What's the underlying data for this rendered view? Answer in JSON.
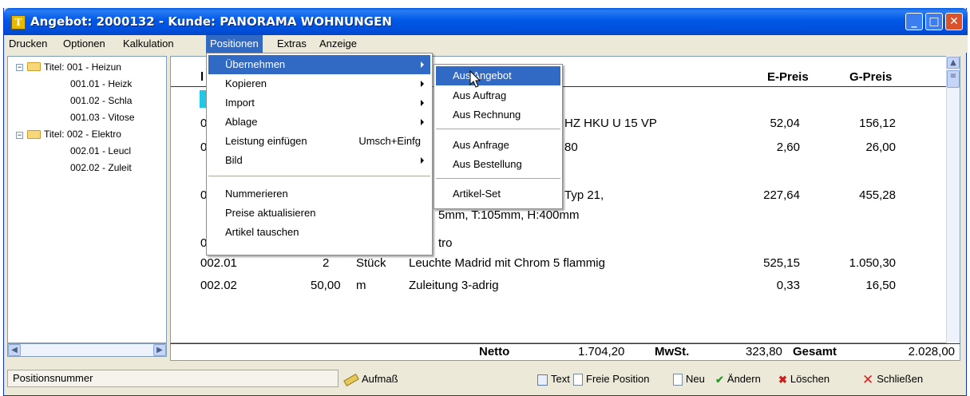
{
  "window": {
    "title": "Angebot: 2000132 - Kunde: PANORAMA WOHNUNGEN",
    "app_icon": "app-logo-icon"
  },
  "menubar": [
    "Drucken",
    "Optionen",
    "Kalkulation",
    "Positionen",
    "Extras",
    "Anzeige"
  ],
  "active_menu": "Positionen",
  "tree": [
    {
      "label": "Titel: 001 - Heizun",
      "level": 0,
      "expanded": true
    },
    {
      "label": "001.01 - Heizk",
      "level": 1
    },
    {
      "label": "001.02 - Schla",
      "level": 1
    },
    {
      "label": "001.03 - Vitose",
      "level": 1
    },
    {
      "label": "Titel: 002 - Elektro",
      "level": 0,
      "expanded": true
    },
    {
      "label": "002.01 - Leucl",
      "level": 1
    },
    {
      "label": "002.02 - Zuleit",
      "level": 1
    }
  ],
  "grid": {
    "headers": {
      "e_preis": "E-Preis",
      "g_preis": "G-Preis"
    },
    "rows": [
      {
        "pos": "0",
        "qty": "",
        "unit": "",
        "text": "HZ HKU U 15 VP",
        "e": "52,04",
        "g": "156,12"
      },
      {
        "pos": "0",
        "qty": "",
        "unit": "",
        "text": "80",
        "e": "2,60",
        "g": "26,00"
      },
      {
        "pos": "0",
        "qty": "",
        "unit": "",
        "text": "Typ 21,",
        "e": "227,64",
        "g": "455,28"
      },
      {
        "pos": "",
        "qty": "",
        "unit": "",
        "text": "5mm, T:105mm, H:400mm",
        "e": "",
        "g": ""
      },
      {
        "pos": "0",
        "qty": "",
        "unit": "",
        "text": "tro",
        "e": "",
        "g": ""
      },
      {
        "pos": "002.01",
        "qty": "2",
        "unit": "Stück",
        "text": "Leuchte Madrid mit Chrom 5 flammig",
        "e": "525,15",
        "g": "1.050,30"
      },
      {
        "pos": "002.02",
        "qty": "50,00",
        "unit": "m",
        "text": "Zuleitung 3-adrig",
        "e": "0,33",
        "g": "16,50"
      }
    ]
  },
  "totals": {
    "netto_label": "Netto",
    "netto": "1.704,20",
    "mwst_label": "MwSt.",
    "mwst": "323,80",
    "gesamt_label": "Gesamt",
    "gesamt": "2.028,00"
  },
  "status": {
    "field": "Positionsnummer",
    "aufmass": "Aufmaß",
    "text": "Text",
    "freie_position": "Freie Position",
    "neu": "Neu",
    "aendern": "Ändern",
    "loeschen": "Löschen",
    "schliessen": "Schließen"
  },
  "positionen_menu": {
    "items": [
      "Übernehmen",
      "Kopieren",
      "Import",
      "Ablage",
      "Leistung einfügen",
      "Bild",
      "Nummerieren",
      "Preise aktualisieren",
      "Artikel tauschen"
    ],
    "shortcut_leistung": "Umsch+Einfg"
  },
  "uebernehmen_menu": [
    "Aus Angebot",
    "Aus Auftrag",
    "Aus Rechnung",
    "Aus Anfrage",
    "Aus Bestellung",
    "Artikel-Set"
  ],
  "colors": {
    "title_bar": "#0058e6",
    "menu_highlight": "#316ac5",
    "close_button": "#d9522b"
  }
}
